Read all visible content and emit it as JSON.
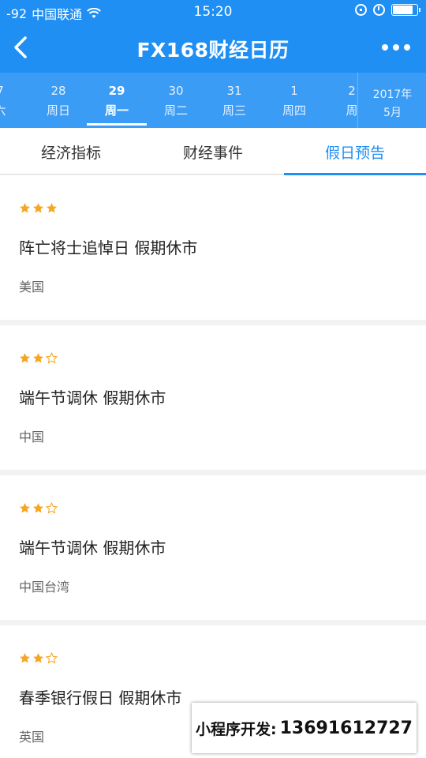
{
  "status_bar": {
    "signal": "-92",
    "carrier": "中国联通",
    "time": "15:20",
    "battery_level": 0.85
  },
  "header": {
    "title": "FX168财经日历",
    "back_icon": "chevron-left-icon",
    "more_icon": "more-dots-icon"
  },
  "date_strip": {
    "items": [
      {
        "day": "7",
        "weekday": "六"
      },
      {
        "day": "28",
        "weekday": "周日"
      },
      {
        "day": "29",
        "weekday": "周一",
        "active": true
      },
      {
        "day": "30",
        "weekday": "周二"
      },
      {
        "day": "31",
        "weekday": "周三"
      },
      {
        "day": "1",
        "weekday": "周四"
      },
      {
        "day": "2",
        "weekday": "周"
      }
    ],
    "year": "2017年",
    "month": "5月"
  },
  "tabs": [
    {
      "label": "经济指标"
    },
    {
      "label": "财经事件"
    },
    {
      "label": "假日预告",
      "active": true
    }
  ],
  "holidays": [
    {
      "stars": 3,
      "title": "阵亡将士追悼日 假期休市",
      "country": "美国"
    },
    {
      "stars": 2,
      "title": "端午节调休 假期休市",
      "country": "中国"
    },
    {
      "stars": 2,
      "title": "端午节调休 假期休市",
      "country": "中国台湾"
    },
    {
      "stars": 2,
      "title": "春季银行假日 假期休市",
      "country": "英国"
    }
  ],
  "dev_banner": {
    "label": "小程序开发:",
    "phone": "13691612727"
  },
  "colors": {
    "primary": "#1f8ff4",
    "star": "#f5a623"
  }
}
